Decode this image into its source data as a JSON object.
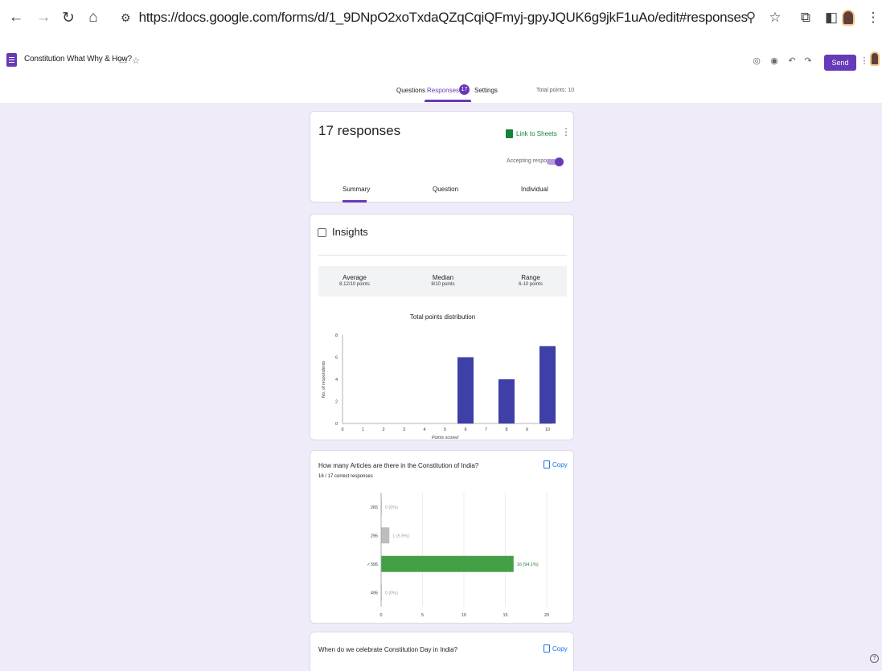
{
  "browser": {
    "url": "https://docs.google.com/forms/d/1_9DNpO2xoTxdaQZqCqiQFmyj-gpyJQUK6g9jkF1uAo/edit#responses"
  },
  "header": {
    "form_title": "Constitution What Why & How?",
    "send_label": "Send"
  },
  "form_tabs": {
    "questions": "Questions",
    "responses": "Responses",
    "responses_badge": "17",
    "settings": "Settings",
    "total_points": "Total points: 10"
  },
  "responses_card": {
    "count": "17 responses",
    "sheets_link": "Link to Sheets",
    "accepting": "Accepting responses",
    "accepting_on": true,
    "tabs": [
      "Summary",
      "Question",
      "Individual"
    ]
  },
  "insights": {
    "title": "Insights",
    "stats": [
      {
        "label": "Average",
        "value": "8.12/10 points"
      },
      {
        "label": "Median",
        "value": "8/10 points"
      },
      {
        "label": "Range",
        "value": "6-10 points"
      }
    ],
    "distribution_title": "Total points distribution"
  },
  "chart_data": [
    {
      "type": "bar",
      "xlabel": "Points scored",
      "ylabel": "No. of respondents",
      "categories": [
        "0",
        "1",
        "2",
        "3",
        "4",
        "5",
        "6",
        "7",
        "8",
        "9",
        "10"
      ],
      "values": [
        0,
        0,
        0,
        0,
        0,
        0,
        6,
        0,
        4,
        0,
        7
      ],
      "ylim": [
        0,
        8
      ],
      "yticks": [
        "0",
        "2",
        "4",
        "6",
        "8"
      ],
      "color": "#3f3fa8",
      "grid": false
    },
    {
      "type": "bar",
      "orientation": "horizontal",
      "categories": [
        "265",
        "295",
        "✓395",
        "495"
      ],
      "values": [
        0,
        1,
        16,
        0
      ],
      "labels": [
        "0 (0%)",
        "1 (5.9%)",
        "16 (94.1%)",
        "0 (0%)"
      ],
      "colors": [
        "#bdbdbd",
        "#bdbdbd",
        "#43a047",
        "#bdbdbd"
      ],
      "xlim": [
        0,
        20
      ],
      "xticks": [
        "0",
        "5",
        "10",
        "15",
        "20"
      ],
      "grid": true
    }
  ],
  "questions": [
    {
      "title": "How many Articles are there in the Constitution of India?",
      "correct": "16 / 17 correct responses",
      "copy_label": "Copy"
    },
    {
      "title": "When do we celebrate Constitution Day in India?",
      "copy_label": "Copy"
    }
  ],
  "help_glyph": "?"
}
